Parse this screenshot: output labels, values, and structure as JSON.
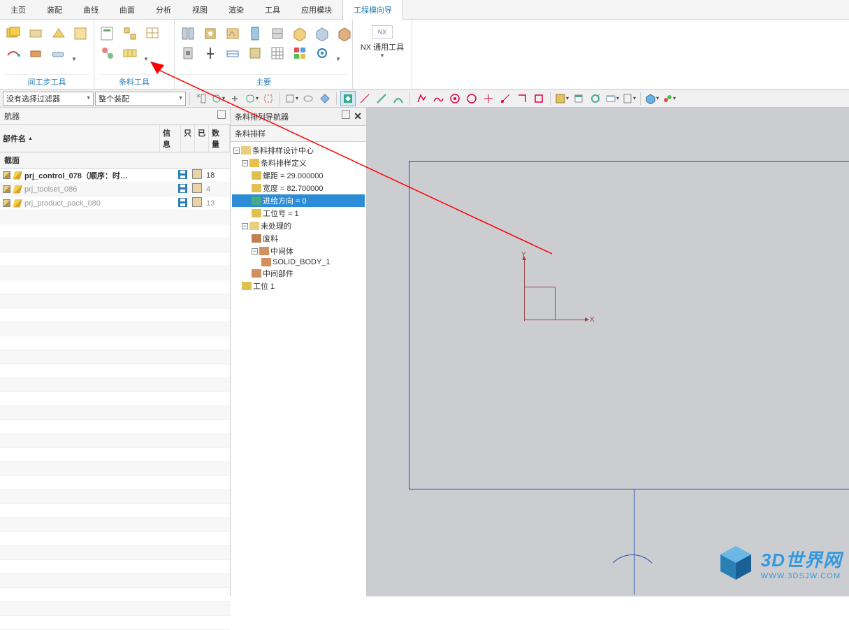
{
  "menu": {
    "items": [
      "主页",
      "装配",
      "曲线",
      "曲面",
      "分析",
      "视图",
      "渲染",
      "工具",
      "应用模块",
      "工程模向导"
    ],
    "active": 9
  },
  "ribbon": {
    "group1_label": "间工步工具",
    "group2_label": "条料工具",
    "group3_label": "主要"
  },
  "nx_tool": {
    "icon": "NX",
    "label": "NX 通用工具"
  },
  "filters": {
    "filter1": "没有选择过滤器",
    "filter2": "整个装配"
  },
  "left_nav": {
    "title": "航器",
    "head": {
      "name": "部件名",
      "info": "信息",
      "ro": "只",
      "state": "已",
      "qty": "数量"
    },
    "section": "截面",
    "rows": [
      {
        "name": "prj_control_078（顺序：时…",
        "qty": "18",
        "bold": true,
        "gray": false
      },
      {
        "name": "prj_toolset_086",
        "qty": "4",
        "bold": false,
        "gray": true
      },
      {
        "name": "prj_product_pack_080",
        "qty": "13",
        "bold": false,
        "gray": true
      }
    ]
  },
  "mid_nav": {
    "title": "条料排列导航器",
    "tab": "条料排样",
    "tree": {
      "root": "条料排样设计中心",
      "def": "条料排样定义",
      "pitch": "螺距 = 29.000000",
      "width": "宽度 = 82.700000",
      "feed": "进给方向 = 0",
      "station_no": "工位号 = 1",
      "unproc": "未处理的",
      "scrap": "废料",
      "inter": "中间体",
      "solid": "SOLID_BODY_1",
      "comp": "中间部件",
      "station": "工位 1"
    }
  },
  "viewport": {
    "ylabel": "Y",
    "xlabel": "X"
  },
  "watermark": {
    "line1": "3D世界网",
    "line2": "WWW.3DSJW.COM"
  }
}
